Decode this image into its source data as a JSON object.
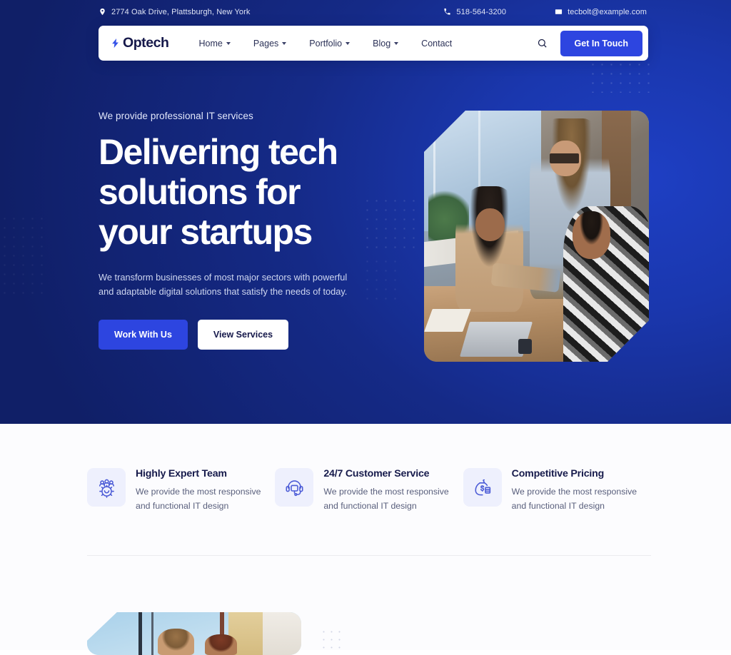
{
  "topbar": {
    "address": "2774 Oak Drive, Plattsburgh, New York",
    "address_icon": "location-pin-icon",
    "phone": "518-564-3200",
    "phone_icon": "phone-icon",
    "email": "tecbolt@example.com",
    "email_icon": "envelope-icon"
  },
  "nav": {
    "brand": "Optech",
    "brand_icon": "lightning-bolt-icon",
    "items": [
      {
        "label": "Home",
        "has_dropdown": true
      },
      {
        "label": "Pages",
        "has_dropdown": true
      },
      {
        "label": "Portfolio",
        "has_dropdown": true
      },
      {
        "label": "Blog",
        "has_dropdown": true
      },
      {
        "label": "Contact",
        "has_dropdown": false
      }
    ],
    "search_icon": "search-icon",
    "cta_label": "Get In Touch"
  },
  "hero": {
    "eyebrow": "We provide professional IT services",
    "headline_line1": "Delivering tech",
    "headline_line2": "solutions for",
    "headline_line3": "your startups",
    "subcopy": "We transform businesses of most major sectors with powerful and adaptable digital solutions that satisfy the needs of today.",
    "primary_button": "Work With Us",
    "secondary_button": "View Services",
    "image_alt": "Three colleagues collaborating around a laptop in an office"
  },
  "features": [
    {
      "icon": "team-gear-icon",
      "title": "Highly Expert Team",
      "description": "We provide the most responsive and functional IT design"
    },
    {
      "icon": "headset-support-icon",
      "title": "24/7 Customer Service",
      "description": "We provide the most responsive and functional IT design"
    },
    {
      "icon": "money-bag-icon",
      "title": "Competitive Pricing",
      "description": "We provide the most responsive and functional IT design"
    }
  ],
  "next_section": {
    "image_alt": "Two people near an office window"
  },
  "colors": {
    "brand_blue": "#2d45e0",
    "hero_navy_dark": "#0e1a5c",
    "hero_blue_bright": "#2142c8",
    "heading_navy": "#161a4b",
    "body_gray": "#595f7c",
    "icon_tile_bg": "#eef0fd",
    "icon_stroke": "#4a5ad6"
  }
}
